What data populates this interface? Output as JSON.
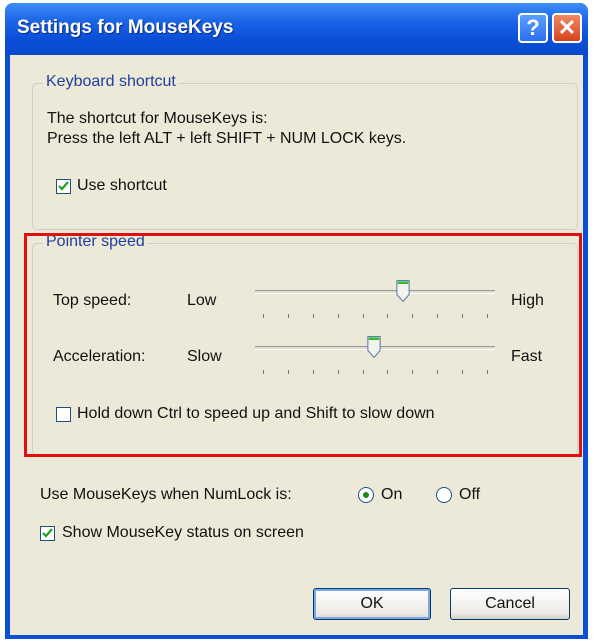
{
  "window": {
    "title": "Settings for MouseKeys"
  },
  "titlebar_buttons": {
    "help": "?",
    "close": "✕"
  },
  "keyboard_shortcut": {
    "legend": "Keyboard shortcut",
    "line1": "The shortcut for MouseKeys is:",
    "line2": "Press the left ALT + left SHIFT + NUM LOCK keys.",
    "use_shortcut_label": "Use shortcut",
    "use_shortcut_checked": true
  },
  "pointer_speed": {
    "legend": "Pointer speed",
    "top_speed": {
      "label": "Top speed:",
      "low": "Low",
      "high": "High",
      "value_fraction": 0.62
    },
    "acceleration": {
      "label": "Acceleration:",
      "low": "Slow",
      "high": "Fast",
      "value_fraction": 0.5
    },
    "hold_ctrl_label": "Hold down Ctrl to speed up and Shift to slow down",
    "hold_ctrl_checked": false
  },
  "numlock": {
    "label": "Use MouseKeys when NumLock is:",
    "on_label": "On",
    "off_label": "Off",
    "selected": "On"
  },
  "show_status": {
    "label": "Show MouseKey status on screen",
    "checked": true
  },
  "buttons": {
    "ok": "OK",
    "cancel": "Cancel"
  },
  "colors": {
    "highlight_border": "#e01010",
    "titlebar": "#0a4fd6",
    "legend_text": "#1f3f9e"
  },
  "icons": [
    "help-icon",
    "close-icon",
    "checkmark-icon"
  ]
}
